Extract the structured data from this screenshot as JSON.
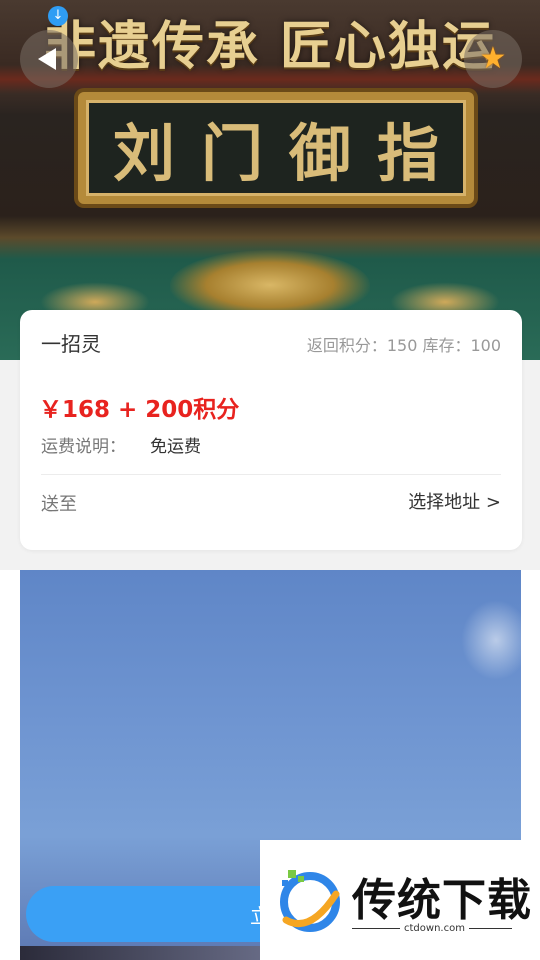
{
  "banner": {
    "slogan": "非遗传承 匠心独运",
    "plaque_title": "刘门御指"
  },
  "nav": {
    "back_icon": "back-arrow-icon",
    "favorite_icon": "star-icon",
    "download_icon": "download-badge-icon"
  },
  "product": {
    "name": "一招灵",
    "meta": "返回积分：150 库存：100",
    "price": "￥168 + 200积分",
    "shipping_label": "运费说明：",
    "shipping_value": "免运费",
    "deliver_to_label": "送至",
    "address_select": "选择地址 >"
  },
  "actions": {
    "buy_label": "立即"
  },
  "watermark": {
    "brand": "传统下载",
    "url": "ctdown.com"
  },
  "colors": {
    "accent": "#3aa0f5",
    "price": "#e8231f",
    "star": "#ffb02e"
  }
}
